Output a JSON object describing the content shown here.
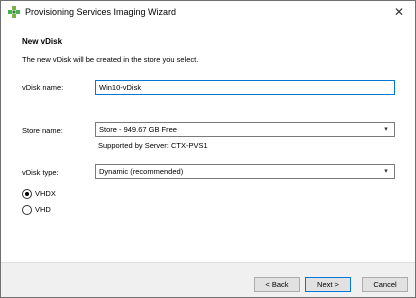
{
  "window": {
    "title": "Provisioning Services Imaging Wizard",
    "close_glyph": "✕",
    "app_icon": "citrix-gear-icon"
  },
  "page": {
    "heading": "New vDisk",
    "description": "The new vDisk will be created in the store you select."
  },
  "vdisk_name": {
    "label": "vDisk name:",
    "value": "Win10-vDisk"
  },
  "store": {
    "label": "Store name:",
    "selected": "Store - 949.67 GB Free",
    "supported_by": "Supported by Server: CTX-PVS1"
  },
  "vdisk_type": {
    "label": "vDisk type:",
    "selected": "Dynamic (recommended)"
  },
  "format_options": [
    {
      "label": "VHDX",
      "checked": true
    },
    {
      "label": "VHD",
      "checked": false
    }
  ],
  "buttons": {
    "back": "< Back",
    "next": "Next >",
    "cancel": "Cancel"
  },
  "colors": {
    "focus_border": "#0078d7",
    "footer_bg": "#f0f0f0",
    "icon_green": "#4caf50"
  }
}
